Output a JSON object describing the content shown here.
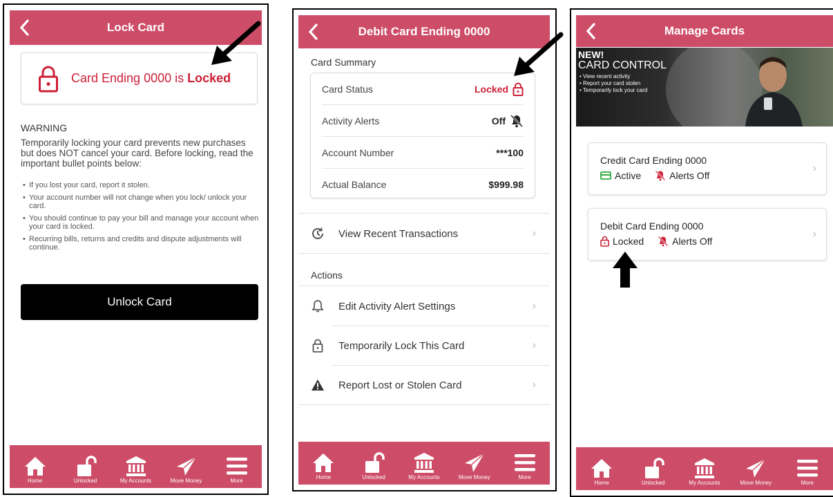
{
  "colors": {
    "brand": "#cd4c67",
    "locked_red": "#cc1f36",
    "active_green": "#2eaa3c",
    "button_black": "#000000"
  },
  "tabs": [
    {
      "label": "Home",
      "icon": "home-icon"
    },
    {
      "label": "Unlocked",
      "icon": "unlocked-padlock-icon"
    },
    {
      "label": "My Accounts",
      "icon": "bank-icon"
    },
    {
      "label": "Move Money",
      "icon": "paper-plane-icon"
    },
    {
      "label": "More",
      "icon": "menu-icon"
    }
  ],
  "screen1": {
    "title": "Lock Card",
    "status_prefix": "Card Ending 0000 is ",
    "status_word": "Locked",
    "warning_title": "WARNING",
    "warning_body": "Temporarily locking your card prevents new purchases but does NOT cancel your card. Before locking, read the important bullet points below:",
    "bullets": [
      "If you lost your card, report it stolen.",
      "Your account number will not change when you lock/ unlock your card.",
      "You should continue to pay your bill and manage your account when your card is locked.",
      "Recurring bills, returns and credits and dispute adjustments will continue."
    ],
    "unlock_button": "Unlock Card"
  },
  "screen2": {
    "title": "Debit Card Ending 0000",
    "summary_label": "Card Summary",
    "rows": [
      {
        "label": "Card Status",
        "value": "Locked"
      },
      {
        "label": "Activity Alerts",
        "value": "Off"
      },
      {
        "label": "Account Number",
        "value": "***100"
      },
      {
        "label": "Actual Balance",
        "value": "$999.98"
      }
    ],
    "view_transactions": "View Recent Transactions",
    "actions_label": "Actions",
    "actions": [
      {
        "label": "Edit Activity Alert Settings",
        "icon": "bell-icon"
      },
      {
        "label": "Temporarily Lock This Card",
        "icon": "padlock-icon"
      },
      {
        "label": "Report Lost or Stolen Card",
        "icon": "warning-triangle-icon"
      }
    ]
  },
  "screen3": {
    "title": "Manage Cards",
    "promo": {
      "new": "NEW!",
      "title": "CARD CONTROL",
      "bullets": [
        "• View recent activity",
        "• Report your card stolen",
        "• Temporarily lock your card"
      ]
    },
    "cards": [
      {
        "name": "Credit Card Ending 0000",
        "status": "Active",
        "alerts": "Alerts Off"
      },
      {
        "name": "Debit Card Ending  0000",
        "status": "Locked",
        "alerts": "Alerts Off"
      }
    ]
  }
}
